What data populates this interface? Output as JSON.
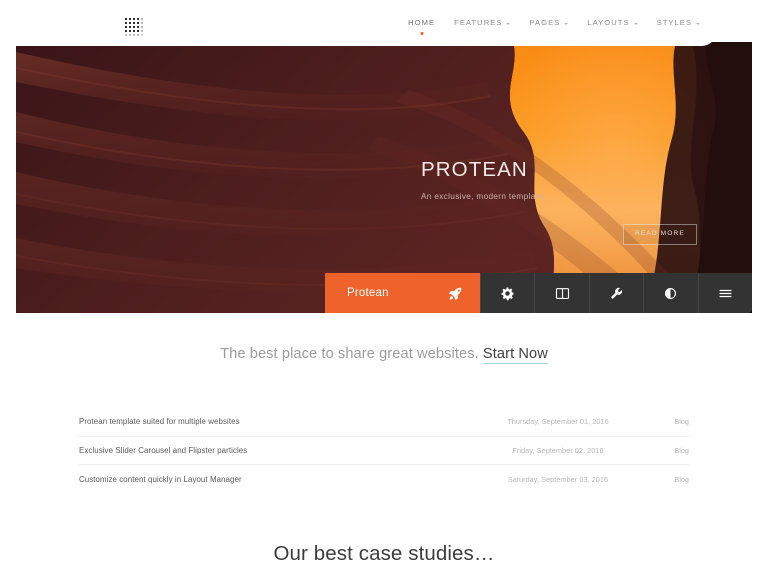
{
  "brand": {
    "accent_color": "#f0622c",
    "logo_icon": "dot-grid-logo"
  },
  "nav": {
    "items": [
      {
        "label": "HOME",
        "icon": "",
        "active": true
      },
      {
        "label": "FEATURES",
        "icon": "chevron-down-icon",
        "active": false
      },
      {
        "label": "PAGES",
        "icon": "chevron-down-icon",
        "active": false
      },
      {
        "label": "LAYOUTS",
        "icon": "chevron-down-icon",
        "active": false
      },
      {
        "label": "STYLES",
        "icon": "chevron-down-icon",
        "active": false
      }
    ]
  },
  "hero": {
    "title": "PROTEAN",
    "subtitle": "An exclusive, modern template",
    "button_label": "READ MORE",
    "image_alt": "slot-canyon-photo"
  },
  "iconbar": {
    "brand_label": "Protean",
    "brand_icon": "rocket-icon",
    "buttons": [
      {
        "icon": "gear-icon"
      },
      {
        "icon": "columns-layout-icon"
      },
      {
        "icon": "wrench-icon"
      },
      {
        "icon": "contrast-icon"
      },
      {
        "icon": "hamburger-menu-icon"
      }
    ]
  },
  "tagline": {
    "text": "The best place to share great websites.",
    "link_label": "Start Now"
  },
  "articles": {
    "rows": [
      {
        "title": "Protean template suited for multiple websites",
        "date": "Thursday, September 01, 2016",
        "category": "Blog"
      },
      {
        "title": "Exclusive Slider Carousel and Flipster particles",
        "date": "Friday, September 02, 2016",
        "category": "Blog"
      },
      {
        "title": "Customize content quickly in Layout Manager",
        "date": "Saturday, September 03, 2016",
        "category": "Blog"
      }
    ]
  },
  "cases": {
    "heading": "Our best case studies…"
  }
}
